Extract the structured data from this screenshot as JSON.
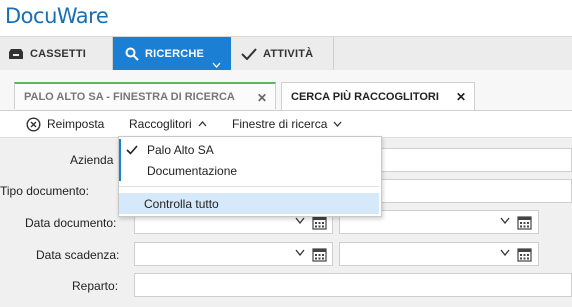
{
  "app": {
    "logo_text": "DocuWare"
  },
  "main_nav": {
    "items": [
      {
        "label": "CASSETTI",
        "icon": "drawer-icon"
      },
      {
        "label": "RICERCHE",
        "icon": "search-icon",
        "active": true
      },
      {
        "label": "ATTIVITÀ",
        "icon": "checkmark-icon"
      }
    ]
  },
  "tabs": [
    {
      "label": "PALO ALTO SA - FINESTRA DI RICERCA",
      "active": false
    },
    {
      "label": "CERCA PIÙ RACCOGLITORI",
      "active": true
    }
  ],
  "toolbar": {
    "reset_label": "Reimposta",
    "cabinets_label": "Raccoglitori",
    "windows_label": "Finestre di ricerca"
  },
  "form": {
    "labels": {
      "company": "Azienda",
      "doc_type": "Tipo documento:",
      "doc_date": "Data documento:",
      "due_date": "Data scadenza:",
      "department": "Reparto:"
    }
  },
  "cabinets_menu": {
    "items": [
      {
        "label": "Palo Alto SA",
        "checked": true
      },
      {
        "label": "Documentazione",
        "checked": false
      }
    ],
    "check_all_label": "Controlla tutto"
  },
  "colors": {
    "accent": "#1b7fd4",
    "active_tab_marker": "#5cb85c",
    "form_bg": "#f0f0f0"
  }
}
